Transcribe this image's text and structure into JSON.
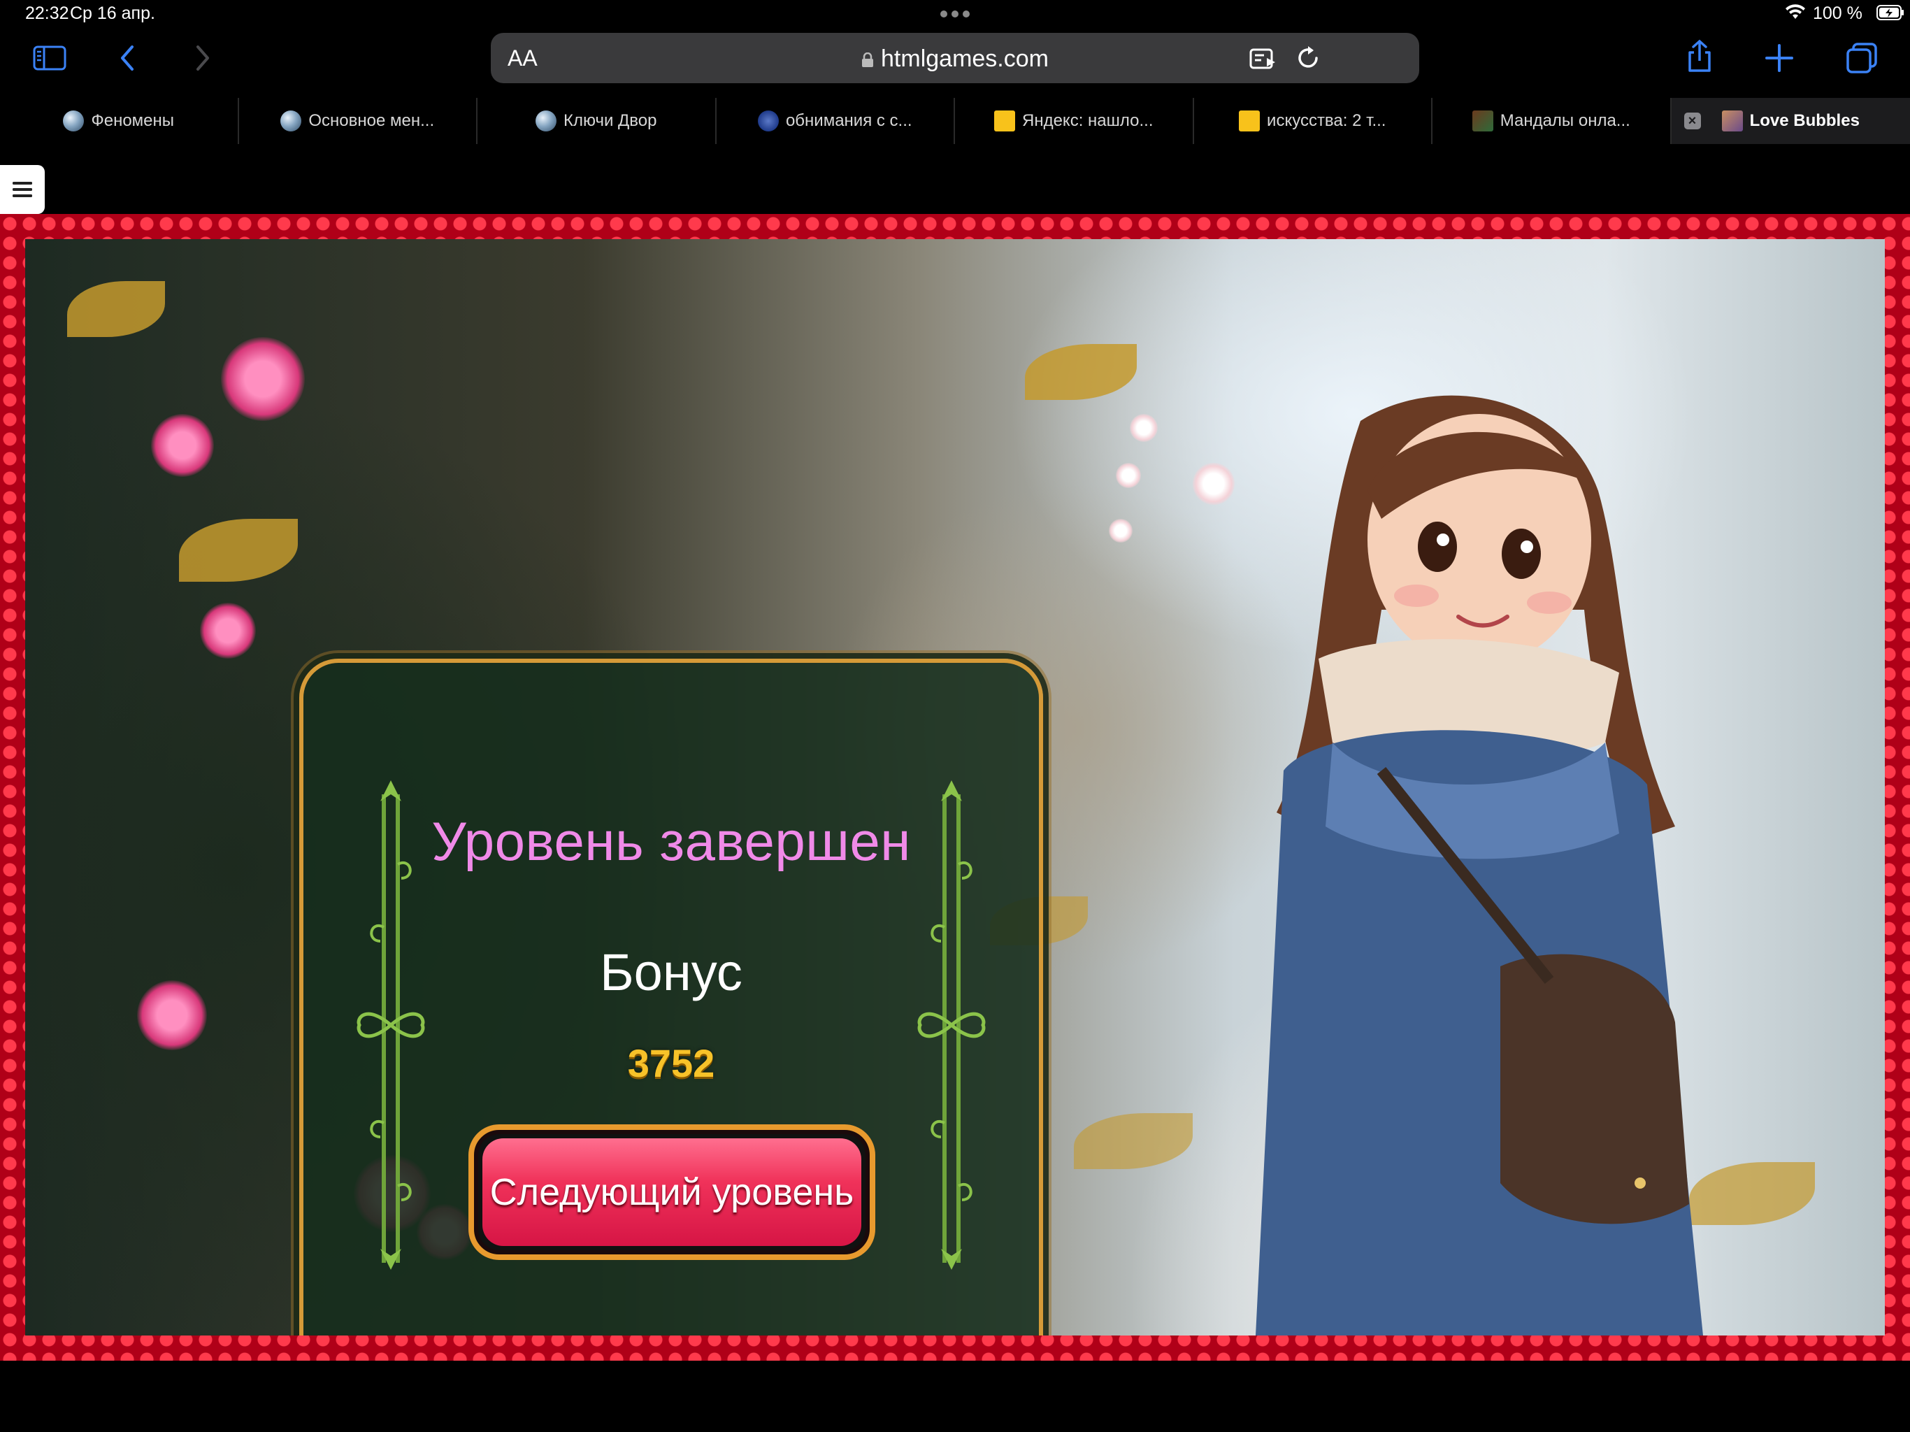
{
  "status_bar": {
    "time": "22:32",
    "date": "Ср 16 апр.",
    "battery": "100 %"
  },
  "toolbar": {
    "text_size_label": "AA",
    "url": "htmlgames.com"
  },
  "tabs": [
    {
      "label": "Феномены",
      "icon": "globe-icon",
      "active": false
    },
    {
      "label": "Основное мен...",
      "icon": "globe-icon",
      "active": false
    },
    {
      "label": "Ключи Двор",
      "icon": "globe-icon",
      "active": false
    },
    {
      "label": "обнимания с с...",
      "icon": "emblem-icon",
      "active": false
    },
    {
      "label": "Яндекс: нашло...",
      "icon": "yandex-icon",
      "active": false
    },
    {
      "label": "искусства: 2 т...",
      "icon": "yandex-icon",
      "active": false
    },
    {
      "label": "Мандалы онла...",
      "icon": "mandala-icon",
      "active": false
    },
    {
      "label": "Love Bubbles",
      "icon": "game-icon",
      "active": true
    }
  ],
  "game": {
    "dialog_title": "Уровень завершен",
    "bonus_label": "Бонус",
    "bonus_score": "3752",
    "next_level_button": "Следующий уровень"
  },
  "colors": {
    "title_pink": "#f08ae8",
    "score_gold": "#f7c229",
    "button_red": "#f0325a",
    "frame_red": "#b00018",
    "dialog_border": "#d59a38"
  }
}
